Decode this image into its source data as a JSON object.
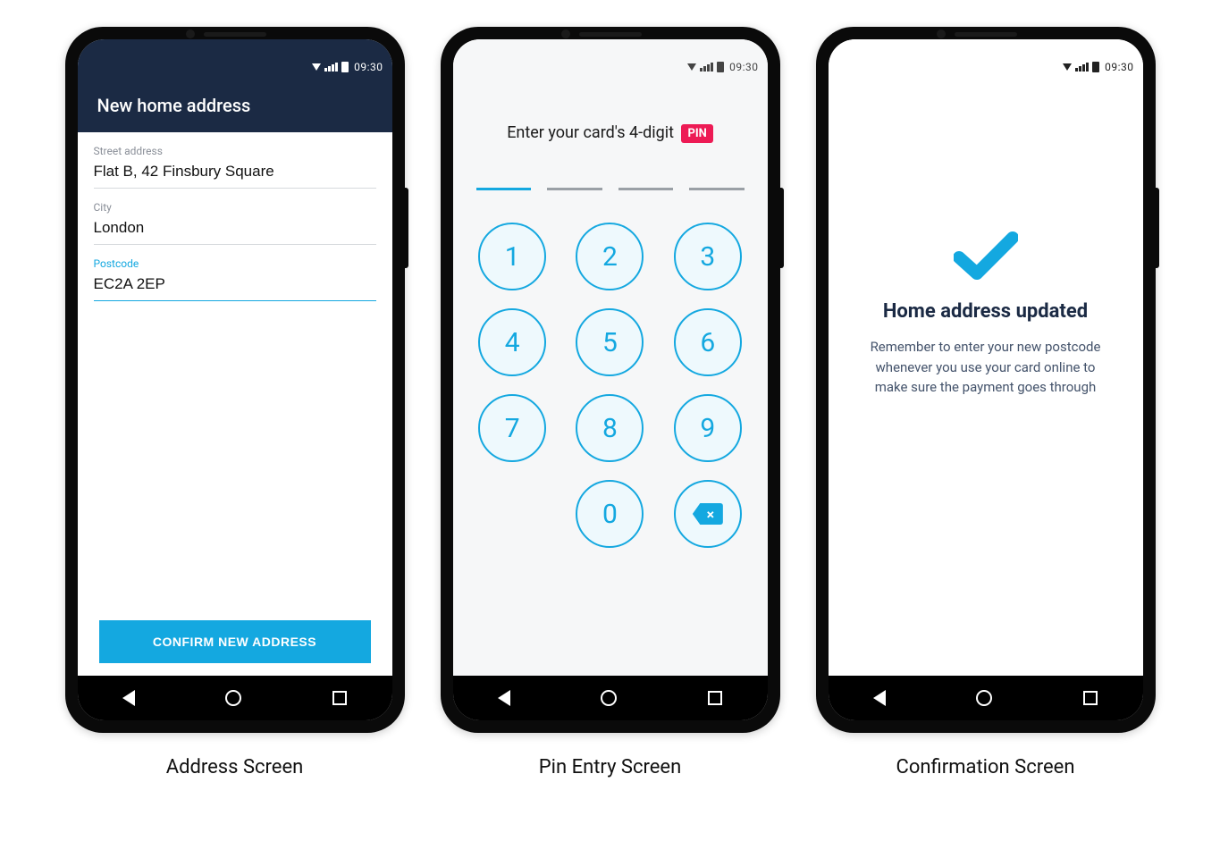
{
  "status": {
    "time": "09:30"
  },
  "address_screen": {
    "appbar_title": "New home address",
    "fields": {
      "street": {
        "label": "Street address",
        "value": "Flat B, 42 Finsbury Square"
      },
      "city": {
        "label": "City",
        "value": "London"
      },
      "postcode": {
        "label": "Postcode",
        "value": "EC2A 2EP"
      }
    },
    "confirm_button": "CONFIRM NEW ADDRESS",
    "caption": "Address Screen"
  },
  "pin_screen": {
    "prompt_prefix": "Enter your card's 4-digit",
    "pin_badge": "PIN",
    "keys": {
      "k1": "1",
      "k2": "2",
      "k3": "3",
      "k4": "4",
      "k5": "5",
      "k6": "6",
      "k7": "7",
      "k8": "8",
      "k9": "9",
      "k0": "0"
    },
    "caption": "Pin Entry Screen"
  },
  "confirmation_screen": {
    "title": "Home address updated",
    "body": "Remember to enter your new postcode whenever you use your card online to make sure the payment goes through",
    "caption": "Confirmation Screen"
  }
}
